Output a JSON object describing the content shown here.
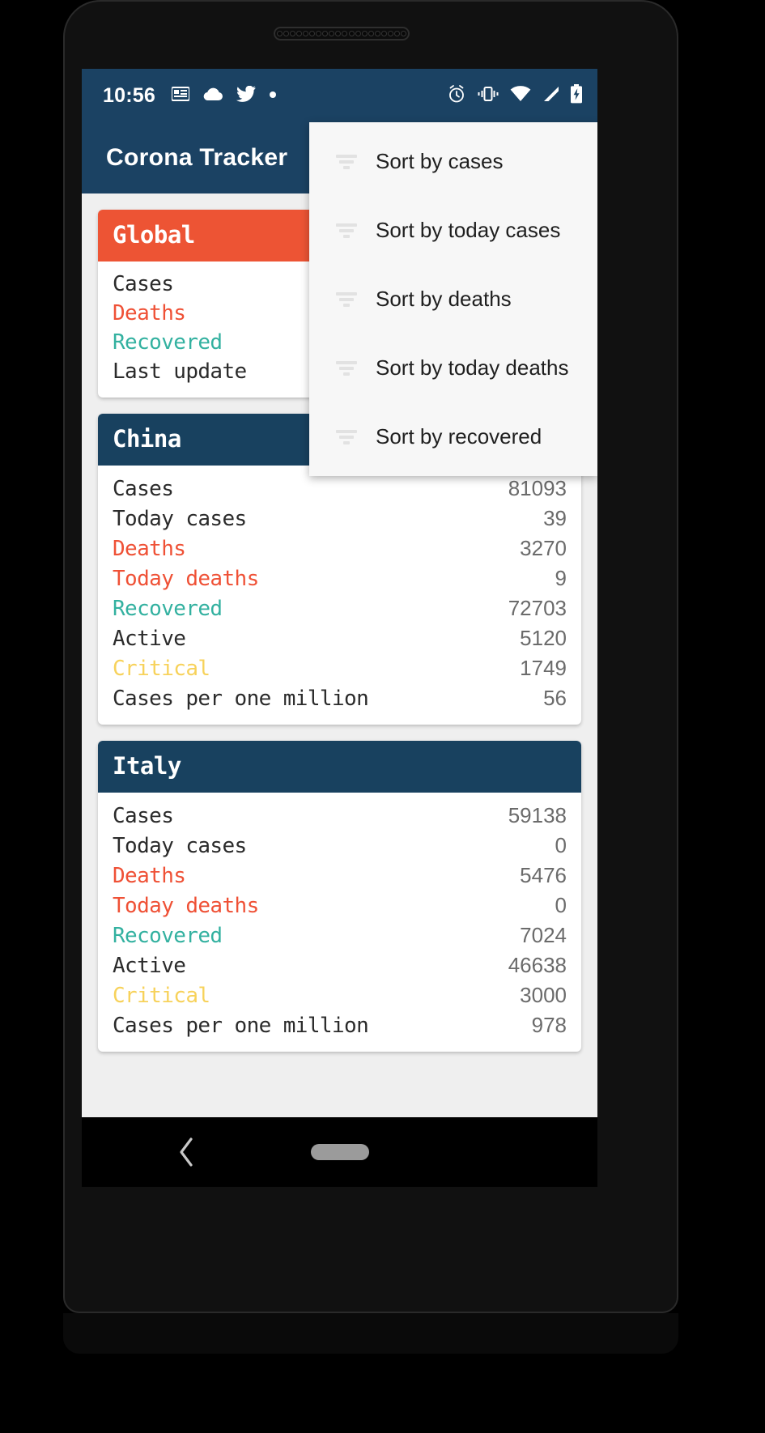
{
  "status_bar": {
    "time": "10:56",
    "left_icons": [
      "news-icon",
      "cloud-icon",
      "twitter-icon",
      "dot-icon"
    ],
    "right_icons": [
      "alarm-icon",
      "vibrate-icon",
      "wifi-icon",
      "signal-icon",
      "battery-charging-icon"
    ]
  },
  "app_bar": {
    "title": "Corona Tracker"
  },
  "menu": {
    "items": [
      {
        "label": "Sort by cases",
        "icon": "sort-icon"
      },
      {
        "label": "Sort by today cases",
        "icon": "sort-icon"
      },
      {
        "label": "Sort by deaths",
        "icon": "sort-icon"
      },
      {
        "label": "Sort by today deaths",
        "icon": "sort-icon"
      },
      {
        "label": "Sort by recovered",
        "icon": "sort-icon"
      }
    ]
  },
  "cards": [
    {
      "title": "Global",
      "header_color": "#ed5434",
      "rows": [
        {
          "label": "Cases",
          "value": "",
          "style": "plain"
        },
        {
          "label": "Deaths",
          "value": "",
          "style": "deaths"
        },
        {
          "label": "Recovered",
          "value": "",
          "style": "recovered"
        },
        {
          "label": "Last update",
          "value": "",
          "style": "plain"
        }
      ]
    },
    {
      "title": "China",
      "header_color": "#18415f",
      "rows": [
        {
          "label": "Cases",
          "value": "81093",
          "style": "plain"
        },
        {
          "label": "Today cases",
          "value": "39",
          "style": "plain"
        },
        {
          "label": "Deaths",
          "value": "3270",
          "style": "deaths"
        },
        {
          "label": "Today deaths",
          "value": "9",
          "style": "deaths"
        },
        {
          "label": "Recovered",
          "value": "72703",
          "style": "recovered"
        },
        {
          "label": "Active",
          "value": "5120",
          "style": "plain"
        },
        {
          "label": "Critical",
          "value": "1749",
          "style": "critical"
        },
        {
          "label": "Cases per one million",
          "value": "56",
          "style": "plain"
        }
      ]
    },
    {
      "title": "Italy",
      "header_color": "#18415f",
      "rows": [
        {
          "label": "Cases",
          "value": "59138",
          "style": "plain"
        },
        {
          "label": "Today cases",
          "value": "0",
          "style": "plain"
        },
        {
          "label": "Deaths",
          "value": "5476",
          "style": "deaths"
        },
        {
          "label": "Today deaths",
          "value": "0",
          "style": "deaths"
        },
        {
          "label": "Recovered",
          "value": "7024",
          "style": "recovered"
        },
        {
          "label": "Active",
          "value": "46638",
          "style": "plain"
        },
        {
          "label": "Critical",
          "value": "3000",
          "style": "critical"
        },
        {
          "label": "Cases per one million",
          "value": "978",
          "style": "plain"
        }
      ]
    }
  ],
  "nav_bar": {
    "back_icon": "chevron-left-icon",
    "home_indicator": "home-pill-icon"
  },
  "colors": {
    "primary": "#1b4263",
    "card_header_country": "#18415f",
    "accent_red": "#ed5434",
    "deaths": "#ef5136",
    "recovered": "#33b1a0",
    "critical": "#f7d25b",
    "background": "#efefef",
    "menu_background": "#f7f7f7",
    "value_text": "#6b6b6b"
  }
}
